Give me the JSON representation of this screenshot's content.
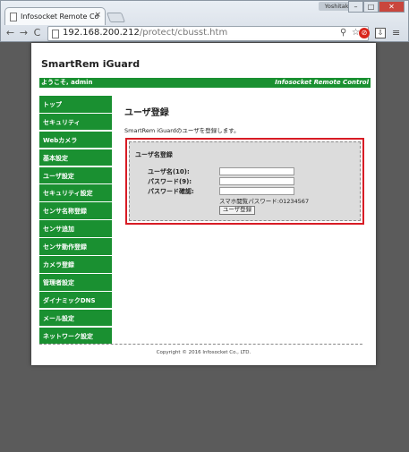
{
  "browser": {
    "tab_title": "Infosocket Remote Co",
    "tab_close": "×",
    "user_label": "Yoshitake",
    "window_minimize": "–",
    "window_maximize": "□",
    "window_close": "✕",
    "back": "←",
    "forward": "→",
    "reload": "C",
    "url_host": "192.168.200.212",
    "url_path": "/protect/cbusst.htm",
    "zoom_glyph": "⚲",
    "star_glyph": "☆",
    "ext1_glyph": "⊘",
    "ext2_glyph": "⇩",
    "menu_glyph": "≡"
  },
  "site": {
    "brand": "SmartRem iGuard",
    "welcome": "ようこそ, admin",
    "company_banner": "Infosocket Remote Control"
  },
  "nav": {
    "items": [
      {
        "label": "トップ"
      },
      {
        "label": "セキュリティ"
      },
      {
        "label": "Webカメラ"
      },
      {
        "label": "基本設定"
      },
      {
        "label": "ユーザ設定"
      },
      {
        "label": "セキュリティ設定"
      },
      {
        "label": "センサ名称登録"
      },
      {
        "label": "センサ追加"
      },
      {
        "label": "センサ動作登録"
      },
      {
        "label": "カメラ登録"
      },
      {
        "label": "管理者設定"
      },
      {
        "label": "ダイナミックDNS"
      },
      {
        "label": "メール設定"
      },
      {
        "label": "ネットワーク設定"
      }
    ]
  },
  "main": {
    "title": "ユーザ登録",
    "description": "SmartRem iGuardのユーザを登録します。"
  },
  "form": {
    "legend": "ユーザ名登録",
    "fields": [
      {
        "label": "ユーザ名(10):",
        "value": ""
      },
      {
        "label": "パスワード(9):",
        "value": ""
      },
      {
        "label": "パスワード確認:",
        "value": ""
      }
    ],
    "note": "スマホ閲覧パスワード:01234567",
    "submit_label": "ユーザ登録"
  },
  "footer": {
    "copyright": "Copyright © 2016 Infosocket Co., LTD."
  },
  "colors": {
    "accent_green": "#1a9031",
    "highlight_red": "#d81c25",
    "backdrop_gray": "#5b5b5b"
  }
}
